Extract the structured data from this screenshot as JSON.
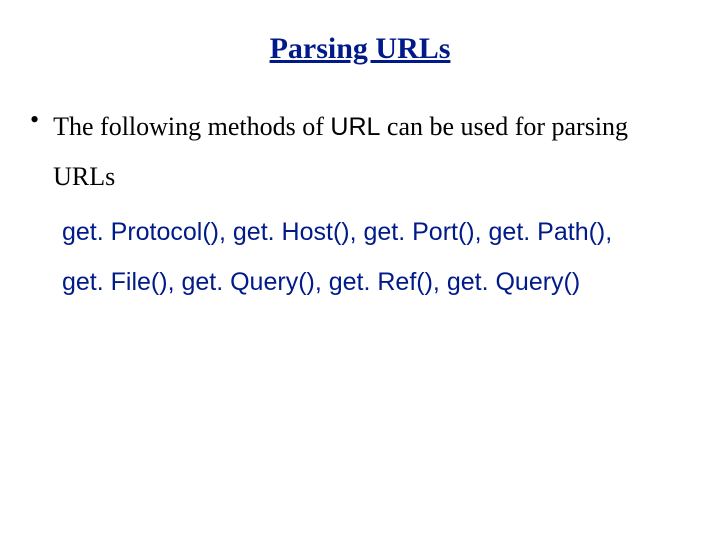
{
  "title": "Parsing URLs",
  "bullet": {
    "prefix": "The following methods of ",
    "class_name": "URL",
    "suffix": " can be used for parsing URLs"
  },
  "methods_line1": "get. Protocol(), get. Host(), get. Port(), get. Path(),",
  "methods_line2": "get. File(), get. Query(), get. Ref(), get. Query()"
}
